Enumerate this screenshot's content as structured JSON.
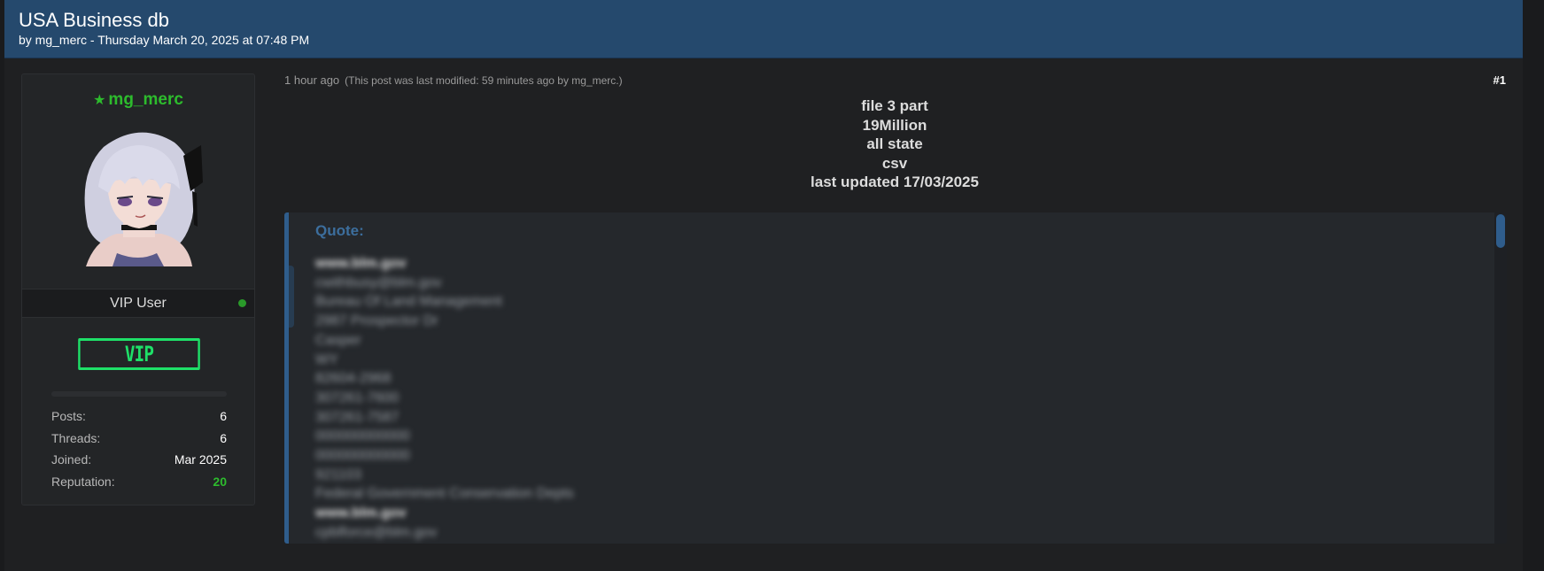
{
  "thread": {
    "title": "USA Business db",
    "byline": "by mg_merc - Thursday March 20, 2025 at 07:48 PM"
  },
  "user": {
    "username": "mg_merc",
    "title": "VIP User",
    "badge": "VIP",
    "stats": [
      {
        "label": "Posts:",
        "value": "6"
      },
      {
        "label": "Threads:",
        "value": "6"
      },
      {
        "label": "Joined:",
        "value": "Mar 2025"
      },
      {
        "label": "Reputation:",
        "value": "20"
      }
    ],
    "online": true
  },
  "post": {
    "time": "1 hour ago",
    "modified": "(This post was last modified: 59 minutes ago by mg_merc.)",
    "number": "#1",
    "body_lines": [
      "file 3 part",
      "19Million",
      "all state",
      "csv",
      "last updated 17/03/2025"
    ],
    "quote_label": "Quote:",
    "quote_lines": [
      "www.blm.gov",
      "cwithbusy@blm.gov",
      "Bureau Of Land Management",
      "2987 Prospector Dr",
      "Casper",
      "WY",
      "82604-2968",
      "307261-7600",
      "307261-7587",
      "000000000000",
      "000000000000",
      "921103",
      "Federal Government Conservation Depts",
      "www.blm.gov",
      "cpblforce@blm.gov"
    ]
  },
  "colors": {
    "header_bg": "#25496d",
    "username": "#2dbb2d",
    "vip_badge": "#1ee068",
    "quote_accent": "#2f5d8c"
  }
}
